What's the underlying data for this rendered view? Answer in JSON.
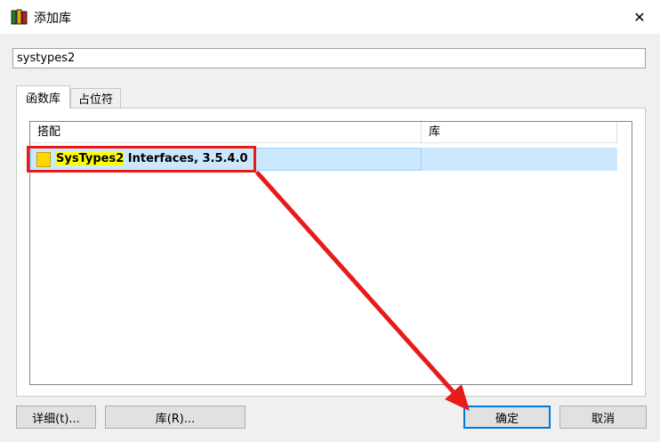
{
  "window": {
    "title": "添加库",
    "icon": "library-books-icon",
    "close_glyph": "✕"
  },
  "search": {
    "value": "systypes2"
  },
  "tabs": [
    {
      "label": "函数库",
      "active": true
    },
    {
      "label": "占位符",
      "active": false
    }
  ],
  "table": {
    "columns": [
      "搭配",
      "库"
    ],
    "rows": [
      {
        "name_highlight": "SysTypes2",
        "name_rest": " Interfaces, 3.5.4.0",
        "library": "",
        "selected": true
      }
    ]
  },
  "buttons": {
    "details": "详细(t)...",
    "library": "库(R)...",
    "ok": "确定",
    "cancel": "取消"
  },
  "colors": {
    "selection": "#cce8ff",
    "annotation_red": "#e81b1b",
    "search_highlight": "#ffff00",
    "default_button_border": "#0078d7"
  }
}
